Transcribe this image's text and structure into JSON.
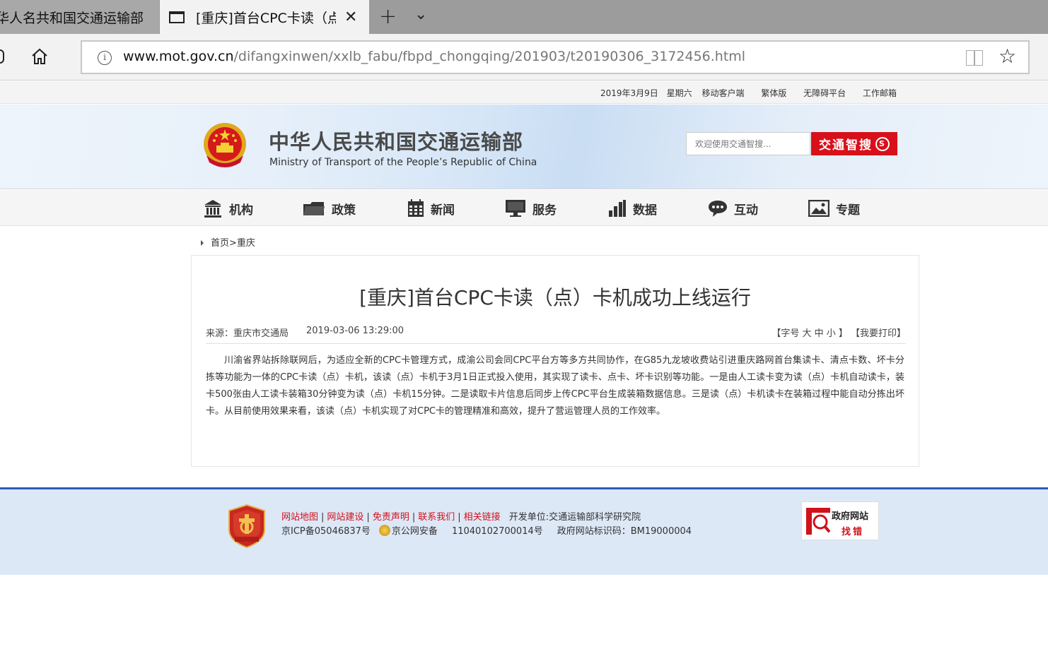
{
  "browser": {
    "inactive_tab_title": "华人名共和国交通运输部",
    "active_tab_title": "[重庆]首台CPC卡读（点",
    "url_host": "www.mot.gov.cn",
    "url_path": "/difangxinwen/xxlb_fabu/fbpd_chongqing/201903/t20190306_3172456.html"
  },
  "topbar": {
    "date": "2019年3月9日",
    "weekday": "星期六",
    "links": [
      "移动客户端",
      "繁体版",
      "无障碍平台",
      "工作邮箱"
    ]
  },
  "header": {
    "site_name_cn": "中华人民共和国交通运输部",
    "site_name_en": "Ministry of Transport of the People’s Republic of China",
    "search_placeholder": "欢迎使用交通智搜...",
    "search_button": "交通智搜"
  },
  "nav": {
    "items": [
      {
        "label": "机构",
        "icon": "building-icon"
      },
      {
        "label": "政策",
        "icon": "folder-icon"
      },
      {
        "label": "新闻",
        "icon": "calendar-icon"
      },
      {
        "label": "服务",
        "icon": "monitor-icon"
      },
      {
        "label": "数据",
        "icon": "bar-chart-icon"
      },
      {
        "label": "互动",
        "icon": "chat-bubble-icon"
      },
      {
        "label": "专题",
        "icon": "picture-icon"
      }
    ]
  },
  "breadcrumb": {
    "home": "首页",
    "sep": ">",
    "current": "重庆"
  },
  "article": {
    "title": "[重庆]首台CPC卡读（点）卡机成功上线运行",
    "source": "来源：重庆市交通局",
    "datetime": "2019-03-06 13:29:00",
    "tools": "【字号 大 中 小 】 【我要打印】",
    "body": "川渝省界站拆除联网后，为适应全新的CPC卡管理方式，成渝公司会同CPC平台方等多方共同协作，在G85九龙坡收费站引进重庆路网首台集读卡、清点卡数、坏卡分拣等功能为一体的CPC卡读（点）卡机，该读（点）卡机于3月1日正式投入使用，其实现了读卡、点卡、坏卡识别等功能。一是由人工读卡变为读（点）卡机自动读卡，装卡500张由人工读卡装箱30分钟变为读（点）卡机15分钟。二是读取卡片信息后同步上传CPC平台生成装箱数据信息。三是读（点）卡机读卡在装箱过程中能自动分拣出坏卡。从目前使用效果来看，该读（点）卡机实现了对CPC卡的管理精准和高效，提升了营运管理人员的工作效率。"
  },
  "footer": {
    "links": [
      "网站地图",
      "网站建设",
      "免责声明",
      "联系我们",
      "相关链接"
    ],
    "developer": "开发单位:交通运输部科学研究院",
    "icp": "京ICP备05046837号",
    "police_record": "京公网安备",
    "police_number": "11040102700014号",
    "site_id": "政府网站标识码：BM19000004",
    "gov_find_line1": "政府网站",
    "gov_find_line2": "找错"
  },
  "colors": {
    "accent_red": "#d8101a",
    "footer_border": "#2c5db5",
    "footer_bg": "#dde8f7"
  }
}
